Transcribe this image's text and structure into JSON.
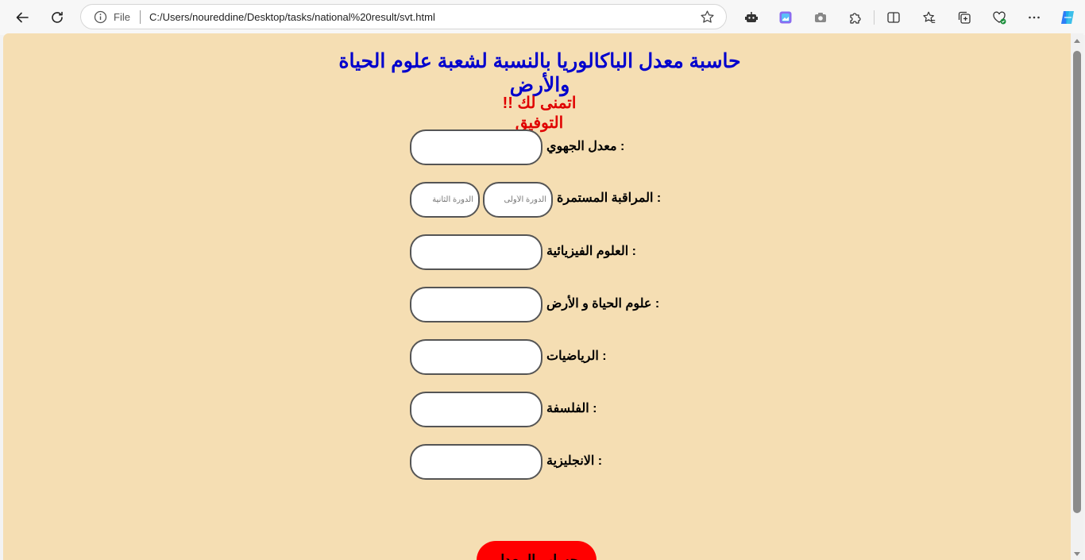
{
  "browser": {
    "url_scheme_label": "File",
    "url": "C:/Users/noureddine/Desktop/tasks/national%20result/svt.html"
  },
  "page": {
    "title": "حاسبة معدل الباكالوريا بالنسبة لشعبة علوم الحياة والأرض",
    "greeting": "!! اتمنى لك التوفيق",
    "fields": {
      "regional": {
        "label": "معدل الجهوي :"
      },
      "continuous": {
        "label": "المراقبة المستمرة :",
        "first_placeholder": "الدورة الأولى",
        "second_placeholder": "الدورة الثانية"
      },
      "physics": {
        "label": "العلوم الفيزيائية :"
      },
      "svt": {
        "label": "علوم الحياة و الأرض :"
      },
      "math": {
        "label": "الرياضيات :"
      },
      "philosophy": {
        "label": "الفلسفة :"
      },
      "english": {
        "label": "الانجليزية :"
      }
    },
    "calculate_button": "حساب المعدل"
  },
  "colors": {
    "page_background": "#f5deb3",
    "title": "#0000cd",
    "greeting": "#e00000",
    "button": "#ff0000"
  },
  "icons": [
    "back-icon",
    "refresh-icon",
    "info-icon",
    "favorite-star-icon",
    "extension-robot-icon",
    "extension-image-icon",
    "screenshot-camera-icon",
    "extensions-puzzle-icon",
    "split-screen-icon",
    "favorites-icon",
    "collections-icon",
    "browser-essentials-icon",
    "more-menu-icon",
    "copilot-icon"
  ]
}
